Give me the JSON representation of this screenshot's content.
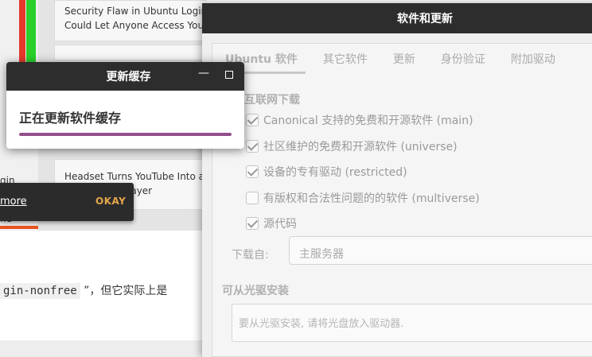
{
  "background_page": {
    "card_1_line_1": "Security Flaw in Ubuntu Login Sc",
    "card_1_line_2": "Could Let Anyone Access Your F",
    "card_2_line_1": "Headset Turns YouTube Into a",
    "card_2_line_2": "layer",
    "left_text_1": "gin",
    "left_text_2": "ne",
    "snackbar_link": "more",
    "snackbar_dot": ".",
    "snackbar_button": "OKAY",
    "code_text": "gin-nonfree",
    "code_suffix": " ”，但它实际上是"
  },
  "software_window": {
    "title": "软件和更新",
    "tabs": [
      {
        "label": "Ubuntu 软件"
      },
      {
        "label": "其它软件"
      },
      {
        "label": "更新"
      },
      {
        "label": "身份验证"
      },
      {
        "label": "附加驱动"
      }
    ],
    "download_section": "互联网下载",
    "options": [
      {
        "label": "Canonical 支持的免费和开源软件 (main)",
        "checked": true
      },
      {
        "label": "社区维护的免费和开源软件 (universe)",
        "checked": true
      },
      {
        "label": "设备的专有驱动 (restricted)",
        "checked": true
      },
      {
        "label": "有版权和合法性问题的的软件 (multiverse)",
        "checked": false
      },
      {
        "label": "源代码",
        "checked": true
      }
    ],
    "download_from_label": "下载自:",
    "download_from_value": "主服务器",
    "cdrom_section": "可从光驱安装",
    "cdrom_placeholder": "要从光驱安装, 请将光盘放入驱动器."
  },
  "update_dialog": {
    "title": "更新缓存",
    "heading": "正在更新软件缓存",
    "progress": 1.0,
    "progress_color": "#924d8b"
  }
}
